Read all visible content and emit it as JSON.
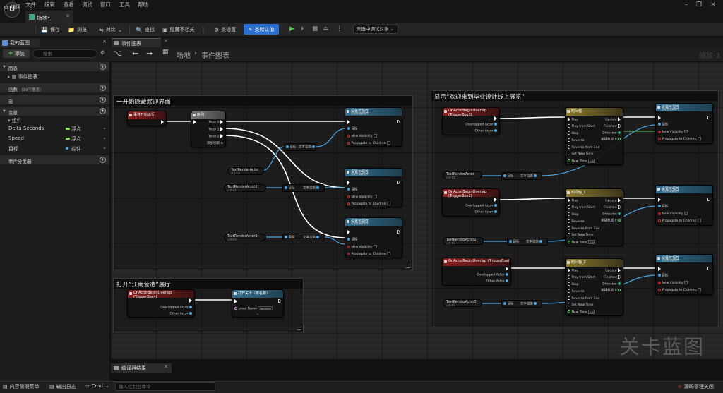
{
  "menu": [
    "文件",
    "编辑",
    "查看",
    "调试",
    "窗口",
    "工具",
    "帮助"
  ],
  "doc_tab": "场地•",
  "toolbar": {
    "compile": "编译",
    "save": "保存",
    "browse": "浏览",
    "diff": "对比",
    "find": "查找",
    "hide_unrelated": "隐藏不相关",
    "class_settings": "类设置",
    "class_defaults": "类默认值",
    "debug_target": "未选中调试对象"
  },
  "left": {
    "tab": "我的蓝图",
    "add": "添加",
    "search_placeholder": "搜索",
    "cat_graphs": "图表",
    "event_graph": "事件图表",
    "cat_functions": "函数",
    "functions_count": "（19可覆盖）",
    "cat_macros": "宏",
    "cat_variables": "变量",
    "components": "组件",
    "variables": [
      {
        "name": "Delta Seconds",
        "type": "浮点"
      },
      {
        "name": "Speed",
        "type": "浮点"
      },
      {
        "name": "目标",
        "type": "控件"
      }
    ],
    "cat_dispatchers": "事件分发器"
  },
  "graph": {
    "tab": "事件图表",
    "crumb_root": "场地",
    "crumb_sep": "›",
    "crumb_leaf": "事件图表",
    "zoom": "缩放-3",
    "watermark": "关卡蓝图",
    "c1_title": "一开始隐藏欢迎界面",
    "c2_title": "打开“江南营造”展厅",
    "c3_title": "显示“欢迎来到毕业设计线上展览”",
    "begin_play": "事件开始运行",
    "sequence": "序列",
    "then0": "Then 0",
    "then1": "Then 1",
    "then2": "Then 2",
    "add_pin": "添加引脚",
    "set_vis": "设置可视性",
    "set_vis_sub": "目标是场景组件",
    "target": "目标",
    "new_visibility": "New Visibility",
    "propagate": "Propagate to Children",
    "text_render": "文本渲染",
    "tra": "TextRenderActor",
    "tra2": "TextRenderActor2",
    "tra3": "TextRenderActor3",
    "from_level": "从关卡中",
    "overlap_box4": "OnActorBeginOverlap (TriggerBox4)",
    "overlap_box3": "OnActorBeginOverlap (TriggerBox3)",
    "overlap_box2": "OnActorBeginOverlap (TriggerBox2)",
    "overlap_box": "OnActorBeginOverlap (TriggerBox)",
    "overlapped_actor": "Overlapped Actor",
    "other_actor": "Other Actor",
    "open_level": "打开关卡（按名称）",
    "level_name": "Level Name",
    "level_value": "Jiangnan",
    "timeline": "时间轴",
    "timeline1": "时间轴_1",
    "timeline2": "时间轴_2",
    "tl_play": "Play",
    "tl_play_start": "Play from Start",
    "tl_stop": "Stop",
    "tl_reverse": "Reverse",
    "tl_reverse_end": "Reverse from End",
    "tl_set_new_time": "Set New Time",
    "tl_new_time": "New Time",
    "tl_update": "Update",
    "tl_finished": "Finished",
    "tl_direction": "Direction",
    "tl_track": "新建轨道 0",
    "tl_value": "0.0"
  },
  "bottom": {
    "compiler_results": "编译器结果",
    "content_drawer": "内容侧滑菜单",
    "output_log": "输出日志",
    "cmd": "Cmd",
    "cmd_placeholder": "输入控制台命令",
    "source_control": "源码管理关闭"
  },
  "colors": {
    "accent": "#2b6fd1",
    "event_red": "#8b1e1e",
    "func_blue": "#2f6d8d",
    "timeline_gold": "#8a7a2a",
    "object_pin": "#4aa3e0"
  }
}
